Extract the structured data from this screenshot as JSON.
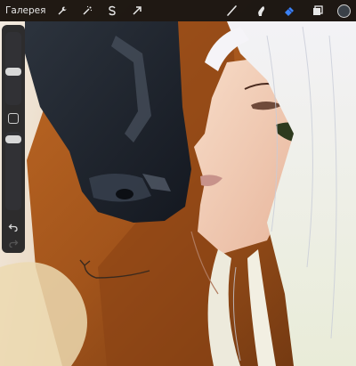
{
  "topbar": {
    "gallery_label": "Галерея",
    "left_tools": [
      {
        "name": "actions-wrench-icon"
      },
      {
        "name": "adjustments-wand-icon"
      },
      {
        "name": "selection-s-icon"
      },
      {
        "name": "transform-arrow-icon"
      }
    ],
    "right_tools": [
      {
        "name": "brush-icon"
      },
      {
        "name": "smudge-icon"
      },
      {
        "name": "eraser-icon",
        "active": true
      },
      {
        "name": "layers-icon"
      }
    ],
    "current_color": "#3a4048"
  },
  "sidebar": {
    "brush_size_level": 0.2,
    "opacity_level": 0.15,
    "modifier_label": "modifier-square",
    "undo_icon": "undo-arrow-icon",
    "redo_icon": "redo-arrow-icon"
  },
  "colors": {
    "accent": "#3b82f6",
    "bar_bg": "#121212",
    "sidebar_bg": "#1c1c1e"
  }
}
